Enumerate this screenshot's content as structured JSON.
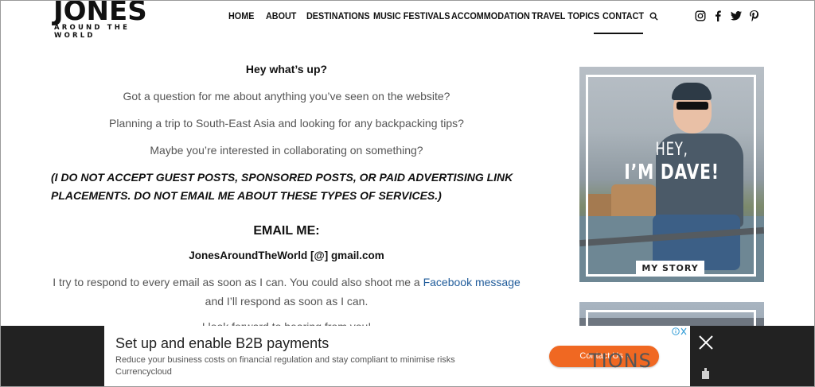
{
  "logo": {
    "main": "JONES",
    "sub": "AROUND THE WORLD"
  },
  "nav": {
    "items": [
      "HOME",
      "ABOUT",
      "DESTINATIONS",
      "MUSIC FESTIVALS",
      "ACCOMMODATION",
      "TRAVEL TOPICS",
      "CONTACT"
    ],
    "active": "CONTACT"
  },
  "social": [
    "instagram-icon",
    "facebook-icon",
    "twitter-icon",
    "pinterest-icon"
  ],
  "content": {
    "greeting": "Hey what’s up?",
    "q1": "Got a question for me about anything you’ve seen on the website?",
    "q2": "Planning a trip to South-East Asia and looking for any backpacking tips?",
    "q3": "Maybe you’re interested in collaborating on something?",
    "disclaimer_line1": "(I DO NOT ACCEPT GUEST POSTS, SPONSORED POSTS, OR PAID ADVERTISING LINK",
    "disclaimer_line2": "PLACEMENTS.  DO NOT EMAIL ME ABOUT THESE TYPES OF SERVICES.)",
    "email_heading": "EMAIL ME:",
    "email_address": "JonesAroundTheWorld [@] gmail.com",
    "respond_text": "I try to respond to every email as soon as I can.   You could also shoot me a ",
    "facebook_link": "Facebook message",
    "respond_text2": "and I’ll respond as soon as I can.",
    "partial": "I look forward to hearing from you!"
  },
  "sidebar": {
    "card_hey": "HEY,",
    "card_name": "I’M DAVE!",
    "card_button": "MY STORY",
    "card2_text": "TIONS"
  },
  "ad": {
    "title": "Set up and enable B2B payments",
    "text": "Reduce your business costs on financial regulation and stay compliant to minimise risks",
    "advertiser": "Currencycloud",
    "button": "Contact Us ›"
  },
  "colors": {
    "link": "#1f5b9a",
    "ad_button": "#f06822",
    "ad_bar": "#222222"
  }
}
